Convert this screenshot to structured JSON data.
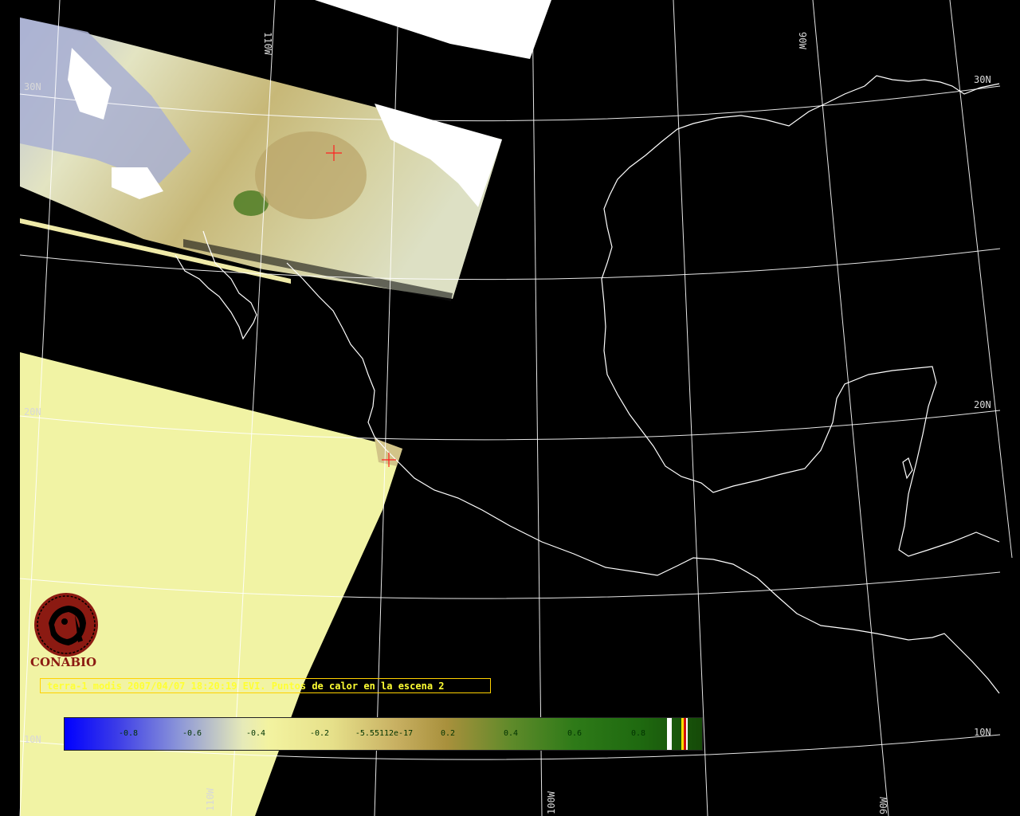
{
  "map": {
    "lat_labels": [
      "30N",
      "20N",
      "10N"
    ],
    "lon_labels": [
      "110W",
      "100W",
      "90W"
    ],
    "colors": {
      "background": "#000000",
      "graticule": "#ffffff",
      "coastline": "#ffffff",
      "ocean_fill": "#f1f3a4",
      "no_data": "#ffffff",
      "hotspot_marker": "#ff2020"
    }
  },
  "caption": "terra-1 modis 2007/04/07 18:20:19 EVI. Puntos de calor en la escena 2",
  "logo": {
    "icon": "conabio-logo-icon",
    "text": "CONABIO"
  },
  "colorbar": {
    "ticks": [
      "-0.8",
      "-0.6",
      "-0.4",
      "-0.2",
      "-5.55112e-17",
      "0.2",
      "0.4",
      "0.6",
      "0.8"
    ]
  }
}
